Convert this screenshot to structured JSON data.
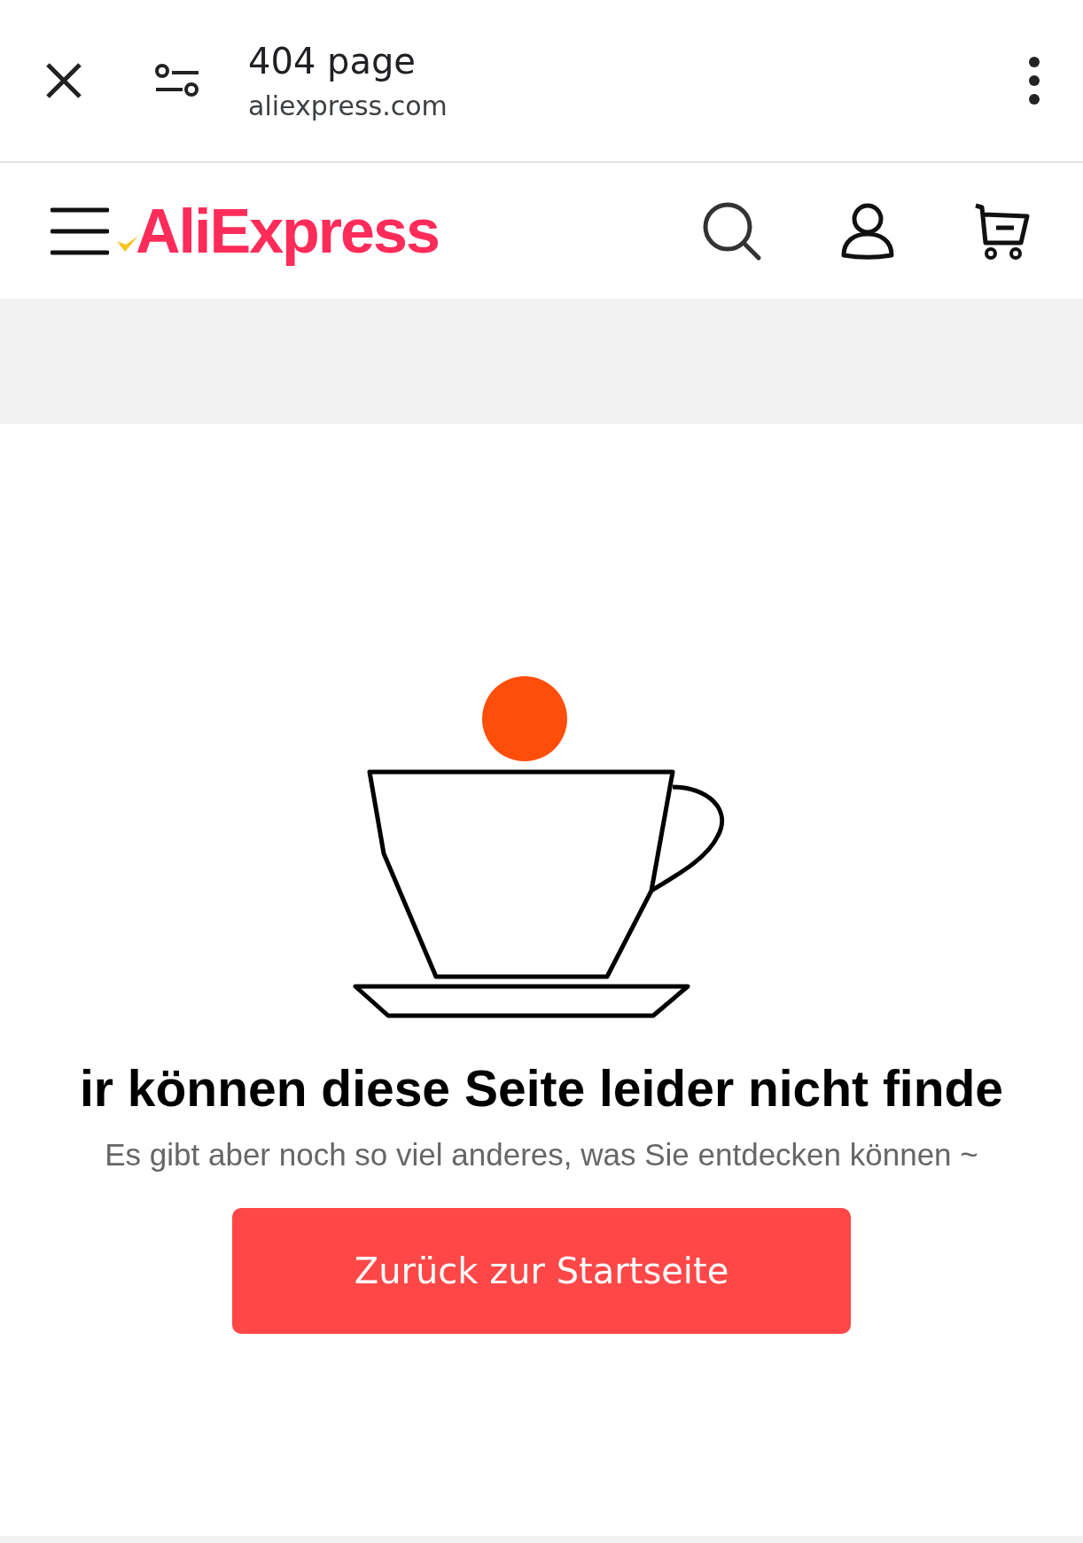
{
  "browser_bar": {
    "title": "404 page",
    "url": "aliexpress.com"
  },
  "site_header": {
    "logo": "AliExpress"
  },
  "error": {
    "heading": "ir können diese Seite leider nicht finde",
    "message": "Es gibt aber noch so viel anderes, was Sie entdecken können ~",
    "button": "Zurück zur Startseite"
  }
}
